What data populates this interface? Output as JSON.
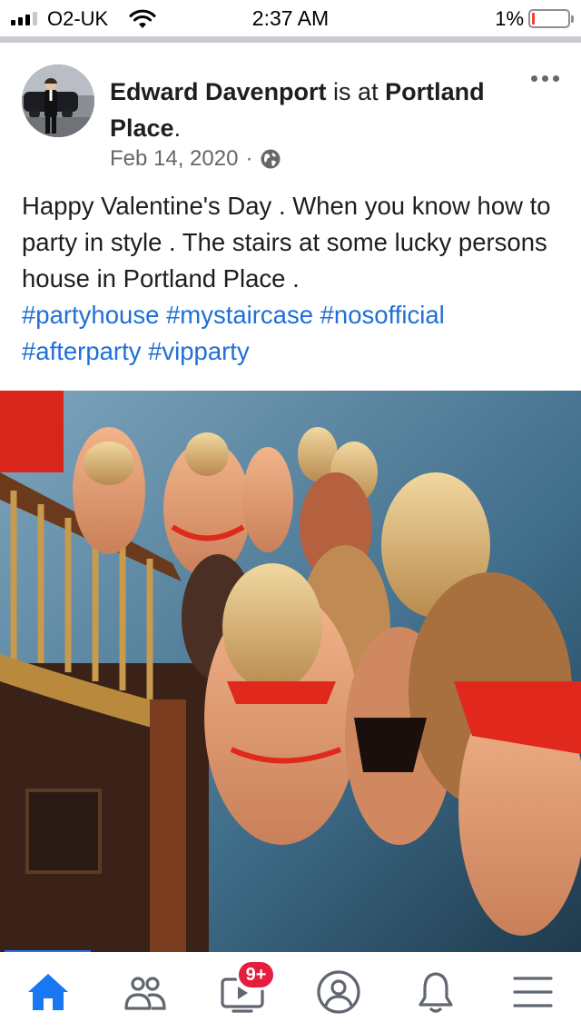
{
  "status_bar": {
    "carrier": "O2-UK",
    "time": "2:37 AM",
    "battery_percent": "1%",
    "battery_level": 0.01,
    "icons": [
      "signal-icon",
      "wifi-icon",
      "battery-icon"
    ]
  },
  "post": {
    "author": "Edward Davenport",
    "is_at": " is at ",
    "location": "Portland Place",
    "location_suffix": ".",
    "date": "Feb 14, 2020",
    "separator": "·",
    "privacy_icon": "globe-icon",
    "more_icon": "more-options-icon",
    "body": "Happy Valentine's Day . When you know how to party in style . The stairs at some lucky persons  house in Portland Place .",
    "hashtags": [
      "#partyhouse",
      "#mystaircase",
      "#nosofficial",
      "#afterparty",
      "#vipparty"
    ]
  },
  "tab_bar": {
    "tabs": [
      {
        "name": "home",
        "icon": "home-icon",
        "active": true
      },
      {
        "name": "friends",
        "icon": "friends-icon",
        "active": false
      },
      {
        "name": "watch",
        "icon": "video-icon",
        "active": false,
        "badge": "9+"
      },
      {
        "name": "profile",
        "icon": "profile-icon",
        "active": false
      },
      {
        "name": "notifications",
        "icon": "bell-icon",
        "active": false
      },
      {
        "name": "menu",
        "icon": "menu-icon",
        "active": false
      }
    ]
  },
  "colors": {
    "accent": "#1877f2",
    "hashtag": "#1f6fd6",
    "badge": "#e41e3f",
    "secondary_text": "#65676b"
  }
}
